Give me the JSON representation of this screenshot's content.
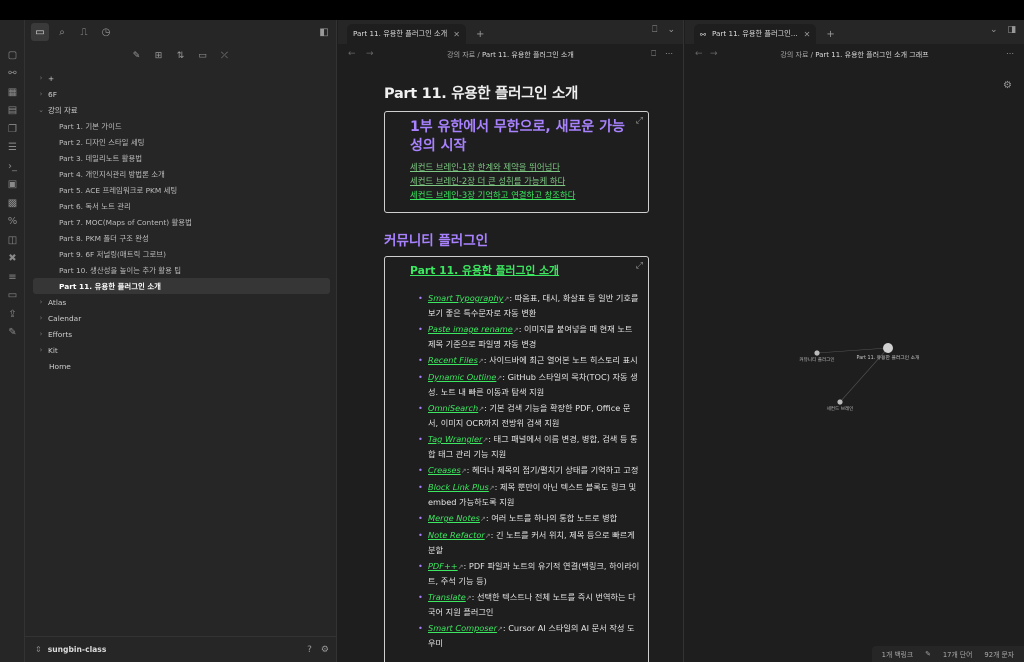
{
  "ribbon": [
    "file-plus-icon",
    "graph-icon",
    "grid-icon",
    "calendar-icon",
    "copy-icon",
    "list-icon",
    "terminal-icon",
    "file-search-icon",
    "template-icon",
    "percent-icon",
    "bookmark-alt-icon",
    "cross-icon",
    "align-icon",
    "layout-icon",
    "export-icon",
    "magic-icon"
  ],
  "sidebar": {
    "tools": [
      "new-note",
      "new-folder",
      "sort",
      "collapse-view",
      "close-all"
    ],
    "tree": [
      {
        "label": "+",
        "kind": "folder"
      },
      {
        "label": "6F",
        "kind": "folder"
      },
      {
        "label": "강의 자료",
        "kind": "folder-open"
      },
      {
        "label": "Part 1. 기본 가이드",
        "kind": "child"
      },
      {
        "label": "Part 2. 디자인 스타일 세팅",
        "kind": "child"
      },
      {
        "label": "Part 3. 데일리노트 활용법",
        "kind": "child"
      },
      {
        "label": "Part 4. 개인지식관리 방법론 소개",
        "kind": "child"
      },
      {
        "label": "Part 5. ACE 프레임워크로 PKM 세팅",
        "kind": "child"
      },
      {
        "label": "Part 6. 독서 노트 관리",
        "kind": "child"
      },
      {
        "label": "Part 7. MOC(Maps of Content) 활용법",
        "kind": "child"
      },
      {
        "label": "Part 8. PKM 폴더 구조 완성",
        "kind": "child"
      },
      {
        "label": "Part 9. 6F 저널링(매트릭 그로브)",
        "kind": "child"
      },
      {
        "label": "Part 10. 생산성을 높이는 추가 활용 팁",
        "kind": "child"
      },
      {
        "label": "Part 11. 유용한 플러그인 소개",
        "kind": "active"
      },
      {
        "label": "Atlas",
        "kind": "folder"
      },
      {
        "label": "Calendar",
        "kind": "folder"
      },
      {
        "label": "Efforts",
        "kind": "folder"
      },
      {
        "label": "Kit",
        "kind": "folder"
      },
      {
        "label": "Home",
        "kind": "home"
      }
    ],
    "vault": "sungbin-class"
  },
  "pane1": {
    "tab": "Part 11. 유용한 플러그인 소개",
    "crumb_parent": "강의 자료",
    "crumb_sep": "/",
    "crumb_current": "Part 11. 유용한 플러그인 소개",
    "title": "Part 11. 유용한 플러그인 소개",
    "card1": {
      "title": "1부 유한에서 무한으로, 새로운 가능성의 시작",
      "links": [
        "세컨드 브레인-1장 한계와 제약을 뛰어넘다",
        "세컨드 브레인-2장 더 큰 성취를 가능케 하다",
        "세컨드 브레인-3장 기억하고 연결하고 창조하다"
      ]
    },
    "section": "커뮤니티 플러그인",
    "card2": {
      "title": "Part 11. 유용한 플러그인 소개",
      "items": [
        {
          "name": "Smart Typography",
          "desc": ": 따옴표, 대시, 화살표 등 일반 기호를 보기 좋은 특수문자로 자동 변환"
        },
        {
          "name": "Paste image rename",
          "desc": ": 이미지를 붙여넣을 때 현재 노트 제목 기준으로 파일명 자동 변경"
        },
        {
          "name": "Recent Files",
          "desc": ": 사이드바에 최근 열어본 노트 히스토리 표시"
        },
        {
          "name": "Dynamic Outline",
          "desc": ": GitHub 스타일의 목차(TOC) 자동 생성. 노트 내 빠른 이동과 탐색 지원"
        },
        {
          "name": "OmniSearch",
          "desc": ": 기본 검색 기능을 확장한 PDF, Office 문서, 이미지 OCR까지 전방위 검색 지원"
        },
        {
          "name": "Tag Wrangler",
          "desc": ": 태그 패널에서 이름 변경, 병합, 검색 등 통합 태그 관리 기능 지원"
        },
        {
          "name": "Creases",
          "desc": ": 헤더나 제목의 접기/펼치기 상태를 기억하고 고정"
        },
        {
          "name": "Block Link Plus",
          "desc": ": 제목 뿐만이 아닌 텍스트 블록도 링크 및 embed 가능하도록 지원"
        },
        {
          "name": "Merge Notes",
          "desc": ": 여러 노트를 하나의 통합 노트로 병합"
        },
        {
          "name": "Note Refactor",
          "desc": ": 긴 노트를 커서 위치, 제목 등으로 빠르게 분할"
        },
        {
          "name": "PDF++",
          "desc": ": PDF 파일과 노트의 유기적 연결(백링크, 하이라이트, 주석 기능 등)"
        },
        {
          "name": "Translate",
          "desc": ": 선택한 텍스트나 전체 노트를 즉시 번역하는 다국어 지원 플러그인"
        },
        {
          "name": "Smart Composer",
          "desc": ": Cursor AI 스타일의 AI 문서 작성 도우미"
        }
      ]
    }
  },
  "pane2": {
    "tab": "Part 11. 유용한 플러그인...",
    "crumb_parent": "강의 자료",
    "crumb_sep": "/",
    "crumb_current": "Part 11. 유용한 플러그인 소개 그래프",
    "graph": {
      "nodes": [
        {
          "id": "a",
          "label": "커뮤니티 플러그인"
        },
        {
          "id": "b",
          "label": "Part 11. 유용한 플러그인 소개"
        },
        {
          "id": "c",
          "label": "세컨드 브레인"
        }
      ]
    },
    "status": {
      "backlinks": "1개 백링크",
      "words": "17개 단어",
      "chars": "92개 문자"
    }
  }
}
